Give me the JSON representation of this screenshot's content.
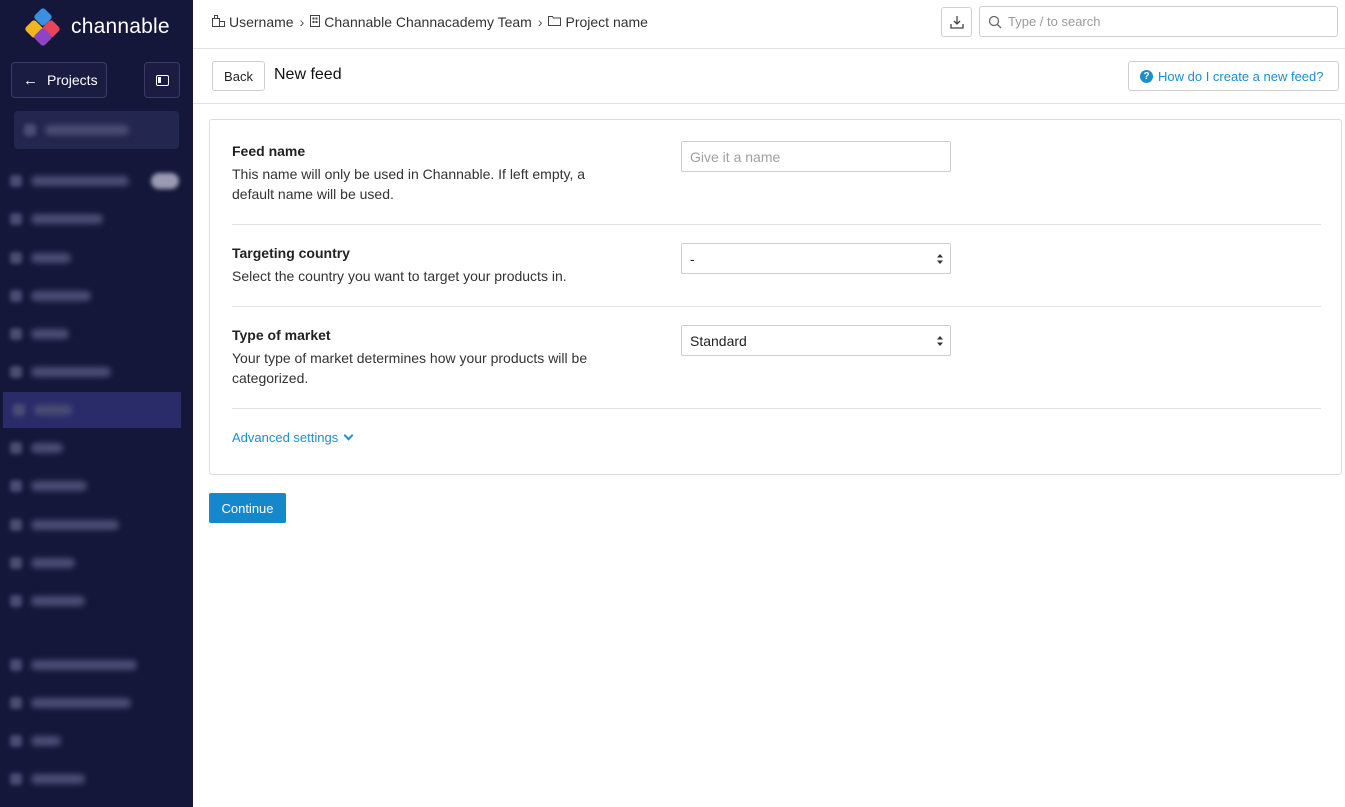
{
  "brand": {
    "name": "channable"
  },
  "sidebar": {
    "projects_label": "Projects",
    "items": [
      {
        "w": 0
      },
      {
        "w": 0
      }
    ]
  },
  "breadcrumb": {
    "user": "Username",
    "team": "Channable Channacademy Team",
    "project": "Project name"
  },
  "search": {
    "placeholder": "Type / to search"
  },
  "page": {
    "back_label": "Back",
    "title": "New feed",
    "help_label": "How do I create a new feed?"
  },
  "form": {
    "feed_name": {
      "title": "Feed name",
      "description": "This name will only be used in Channable. If left empty, a default name will be used.",
      "placeholder": "Give it a name"
    },
    "country": {
      "title": "Targeting country",
      "description": "Select the country you want to target your products in.",
      "value": "-"
    },
    "market": {
      "title": "Type of market",
      "description": "Your type of market determines how your products will be categorized.",
      "value": "Standard"
    },
    "advanced_label": "Advanced settings",
    "continue_label": "Continue"
  }
}
